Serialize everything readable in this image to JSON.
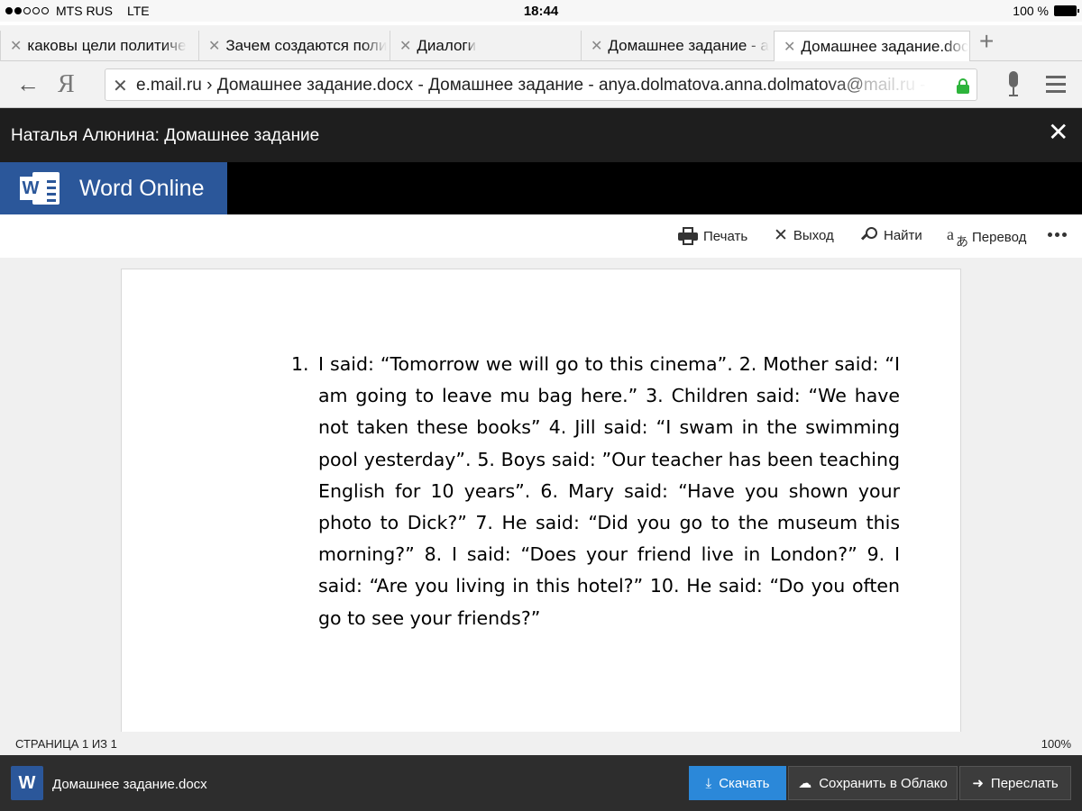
{
  "status_bar": {
    "carrier": "MTS RUS",
    "network": "LTE",
    "time": "18:44",
    "battery": "100 %"
  },
  "tabs": [
    {
      "label": "каковы цели политиче"
    },
    {
      "label": "Зачем создаются поли"
    },
    {
      "label": "Диалоги"
    },
    {
      "label": "Домашнее задание - a"
    },
    {
      "label": "Домашнее задание.doc",
      "active": true
    }
  ],
  "address_bar": {
    "url_prefix": "e.mail.ru",
    "url_path": " › Домашнее задание.docx - Домашнее задание - anya.dolmatova.anna.dolmatova@",
    "url_suffix": "mail.ru - П",
    "secure": true
  },
  "doc_header": {
    "title": "Наталья Алюнина: Домашнее задание"
  },
  "app": {
    "brand": "Word Online",
    "brand_color": "#2b579a"
  },
  "toolbar": {
    "print": "Печать",
    "exit": "Выход",
    "find": "Найти",
    "translate": "Перевод"
  },
  "document": {
    "number": "1.",
    "text": "I said: “Tomorrow we will go to this cinema”. 2. Mother said: “I am going to leave mu bag here.” 3. Children said: “We have not taken these books” 4. Jill said: “I swam in the swimming pool yesterday”. 5. Boys said: ”Our teacher has been teaching English for 10 years”. 6. Mary said: “Have you shown your photo to Dick?” 7. He said: “Did you go to the museum this morning?” 8. I said: “Does your friend live in London?” 9. I said: “Are you living in this hotel?” 10. He said: “Do you often go to see your friends?”"
  },
  "page_status": {
    "page": "СТРАНИЦА 1 ИЗ 1",
    "zoom": "100%"
  },
  "bottom_bar": {
    "file_icon_letter": "W",
    "file_name": "Домашнее задание.docx",
    "download": "Скачать",
    "save_cloud": "Сохранить в Облако",
    "forward": "Переслать",
    "accent": "#2b88d9"
  }
}
